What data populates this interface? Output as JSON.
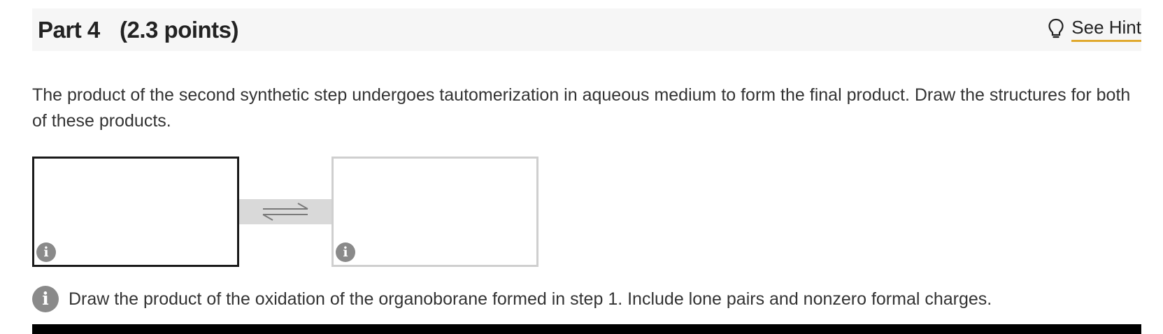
{
  "header": {
    "part_label": "Part 4",
    "points_label": "(2.3 points)",
    "hint_label": "See Hint",
    "hint_icon": "lightbulb-icon"
  },
  "question": {
    "text": "The product of the second synthetic step undergoes tautomerization in aqueous medium to form the final product. Draw the structures for both of these products."
  },
  "drawing": {
    "left_box_info_glyph": "i",
    "right_box_info_glyph": "i",
    "arrow_icon": "equilibrium-arrows-icon"
  },
  "instruction": {
    "info_glyph": "i",
    "text": "Draw the product of the oxidation of the organoborane formed in step 1. Include lone pairs and nonzero formal charges."
  },
  "colors": {
    "header_bg": "#f6f6f6",
    "hint_underline": "#e0a92e",
    "info_badge": "#8a8a8a",
    "active_border": "#1a1a1a",
    "inactive_border": "#cfcfcf",
    "equilibrium_bar": "#d9d9d9"
  }
}
